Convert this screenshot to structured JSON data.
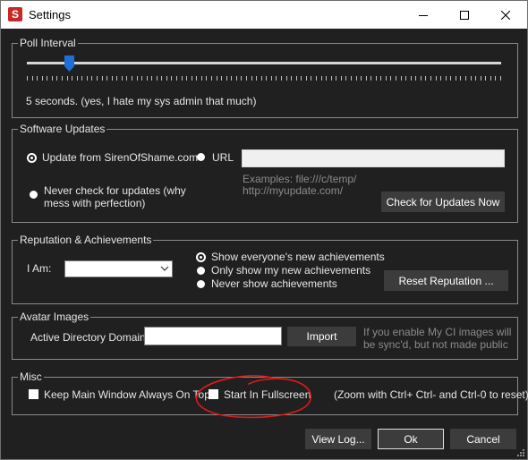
{
  "window": {
    "title": "Settings",
    "app_icon_letter": "S",
    "accent_color": "#1e6fd8",
    "annotation_color": "#e01b1b"
  },
  "poll_interval": {
    "legend": "Poll Interval",
    "slider_value_fraction": 0.09,
    "description": "5 seconds. (yes, I hate my sys admin that much)"
  },
  "software_updates": {
    "legend": "Software Updates",
    "radio_siren": "Update from SirenOfShame.com",
    "radio_url": "URL",
    "radio_never": "Never check for updates (why mess with perfection)",
    "selected": "Update from SirenOfShame.com",
    "url_value": "",
    "examples_line1": "Examples: file:///c/temp/",
    "examples_line2": "http://myupdate.com/",
    "check_button": "Check for Updates Now"
  },
  "reputation": {
    "legend": "Reputation & Achievements",
    "i_am_label": "I Am:",
    "i_am_value": "",
    "radio_everyone": "Show everyone's new achievements",
    "radio_only_mine": "Only show my new achievements",
    "radio_never": "Never show achievements",
    "selected": "Show everyone's new achievements",
    "reset_button": "Reset Reputation ..."
  },
  "avatar": {
    "legend": "Avatar Images",
    "domain_label": "Active Directory Domain:",
    "domain_value": "",
    "import_button": "Import",
    "note": "If you enable My CI images will be sync'd, but not made public"
  },
  "misc": {
    "legend": "Misc",
    "keep_main_window": "Keep Main Window Always On Top",
    "keep_main_window_checked": false,
    "start_fullscreen": "Start In Fullscreen",
    "start_fullscreen_checked": false,
    "zoom_note": "(Zoom with Ctrl+ Ctrl- and Ctrl-0 to reset)"
  },
  "footer": {
    "view_log_button": "View Log...",
    "ok_button": "Ok",
    "cancel_button": "Cancel"
  }
}
